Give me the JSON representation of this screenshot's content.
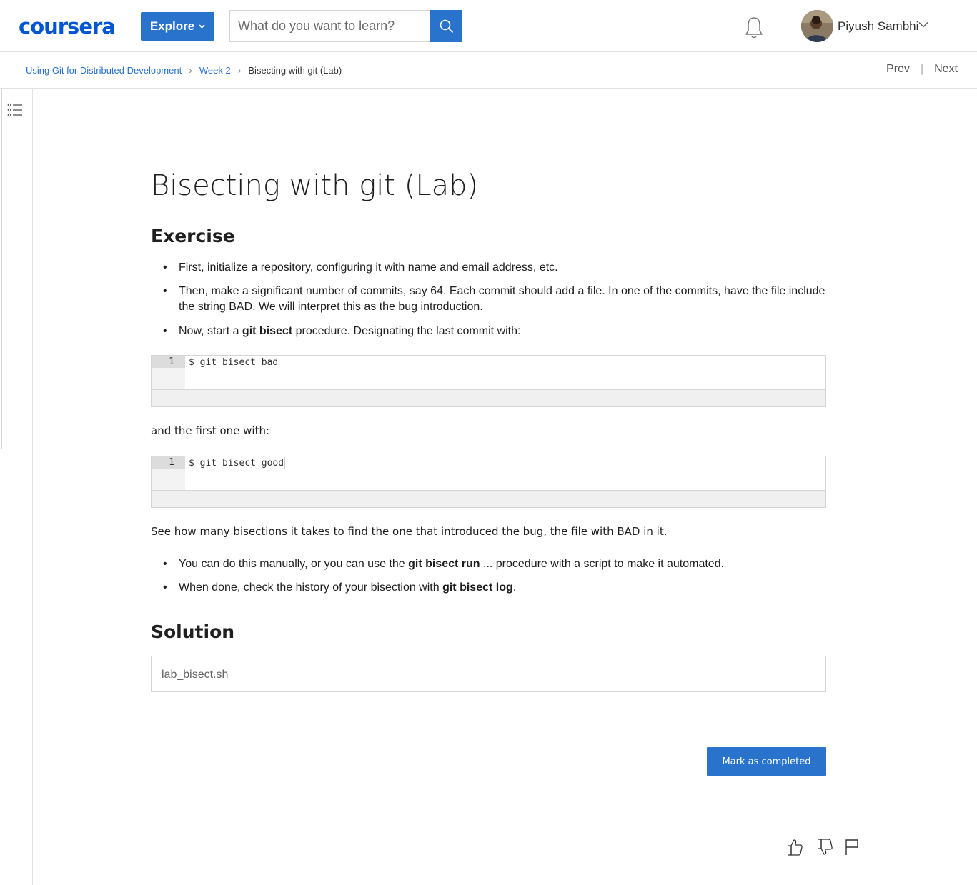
{
  "header": {
    "logo": "coursera",
    "explore_label": "Explore",
    "search_placeholder": "What do you want to learn?",
    "user_name": "Piyush Sambhi",
    "brand_color": "#0056d2",
    "accent_color": "#2a73cc"
  },
  "breadcrumb": {
    "items": [
      "Using Git for Distributed Development",
      "Week 2",
      "Bisecting with git (Lab)"
    ],
    "prev_label": "Prev",
    "next_label": "Next",
    "separator": "|"
  },
  "main": {
    "title": "Bisecting with git (Lab)",
    "exercise_heading": "Exercise",
    "bullets_1": [
      {
        "text": "First, initialize a repository, configuring it with name and email address, etc."
      },
      {
        "text": "Then, make a significant number of commits, say 64. Each commit should add a file. In one of the commits, have the file include the string BAD. We will interpret this as the bug introduction."
      },
      {
        "pre": "Now, start a ",
        "bold": "git bisect",
        "post": " procedure. Designating the last commit with:"
      }
    ],
    "code_1": {
      "line_number": "1",
      "code": "$ git bisect bad"
    },
    "para_1": "and the first one with:",
    "code_2": {
      "line_number": "1",
      "code": "$ git bisect good"
    },
    "para_2": "See how many bisections it takes to find the one that introduced the bug, the file with BAD in it.",
    "bullets_2": [
      {
        "pre": "You can do this manually, or you can use the ",
        "bold": "git bisect run",
        "post": " ... procedure with a script to make it automated."
      },
      {
        "pre": "When done, check the history of your bisection with ",
        "bold": "git bisect log",
        "post": "."
      }
    ],
    "solution_heading": "Solution",
    "solution_file": "lab_bisect.sh",
    "complete_label": "Mark as completed"
  },
  "footer": {
    "icons": [
      "thumbs-up-icon",
      "thumbs-down-icon",
      "flag-icon"
    ]
  }
}
